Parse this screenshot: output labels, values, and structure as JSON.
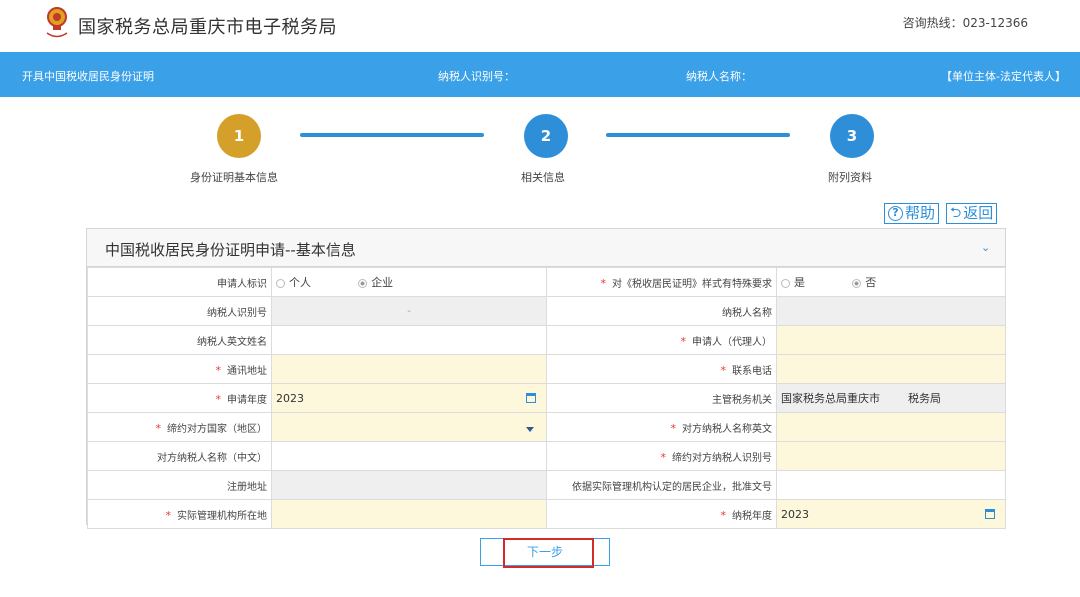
{
  "header": {
    "site_title": "国家税务总局重庆市电子税务局",
    "hotline": "咨询热线：023-12366"
  },
  "nav": {
    "page_name": "开具中国税收居民身份证明",
    "taxpayer_id_label": "纳税人识别号：",
    "taxpayer_name_label": "纳税人名称：",
    "role": "【单位主体-法定代表人】"
  },
  "steps": [
    {
      "number": "1",
      "label": "身份证明基本信息",
      "status": "active"
    },
    {
      "number": "2",
      "label": "相关信息",
      "status": "pending"
    },
    {
      "number": "3",
      "label": "附列资料",
      "status": "pending"
    }
  ],
  "toolbar": {
    "help_label": "帮助",
    "back_label": "返回"
  },
  "panel": {
    "title": "中国税收居民身份证明申请--基本信息"
  },
  "form": {
    "applicant_type_label": "申请人标识",
    "applicant_type_options": [
      "个人",
      "企业"
    ],
    "applicant_type_selected": "企业",
    "special_req_label": "对《税收居民证明》样式有特殊要求",
    "special_req_options": [
      "是",
      "否"
    ],
    "special_req_selected": "否",
    "taxpayer_id_label": "纳税人识别号",
    "taxpayer_id_value": "-",
    "taxpayer_name_label": "纳税人名称",
    "english_name_label": "纳税人英文姓名",
    "applicant_agent_label": "申请人（代理人）",
    "address_label": "通讯地址",
    "phone_label": "联系电话",
    "apply_year_label": "申请年度",
    "apply_year_value": "2023",
    "tax_authority_label": "主管税务机关",
    "tax_authority_value": "国家税务总局重庆市        税务局",
    "treaty_country_label": "缔约对方国家（地区）",
    "counterparty_name_en_label": "对方纳税人名称英文",
    "counterparty_name_cn_label": "对方纳税人名称（中文）",
    "treaty_taxpayer_id_label": "缔约对方纳税人识别号",
    "registered_address_label": "注册地址",
    "resident_enterprise_doc_label": "依据实际管理机构认定的居民企业，批准文号",
    "management_location_label": "实际管理机构所在地",
    "tax_year_label": "纳税年度",
    "tax_year_value": "2023"
  },
  "actions": {
    "next_label": "下一步"
  },
  "colors": {
    "nav_blue": "#3aa0e8",
    "step_active": "#d4a02a",
    "step_pending": "#2e8fd8",
    "required_star": "#e33333",
    "required_field_bg": "#fdf8dc",
    "readonly_field_bg": "#efefef",
    "highlight_red": "#d32a2a"
  }
}
